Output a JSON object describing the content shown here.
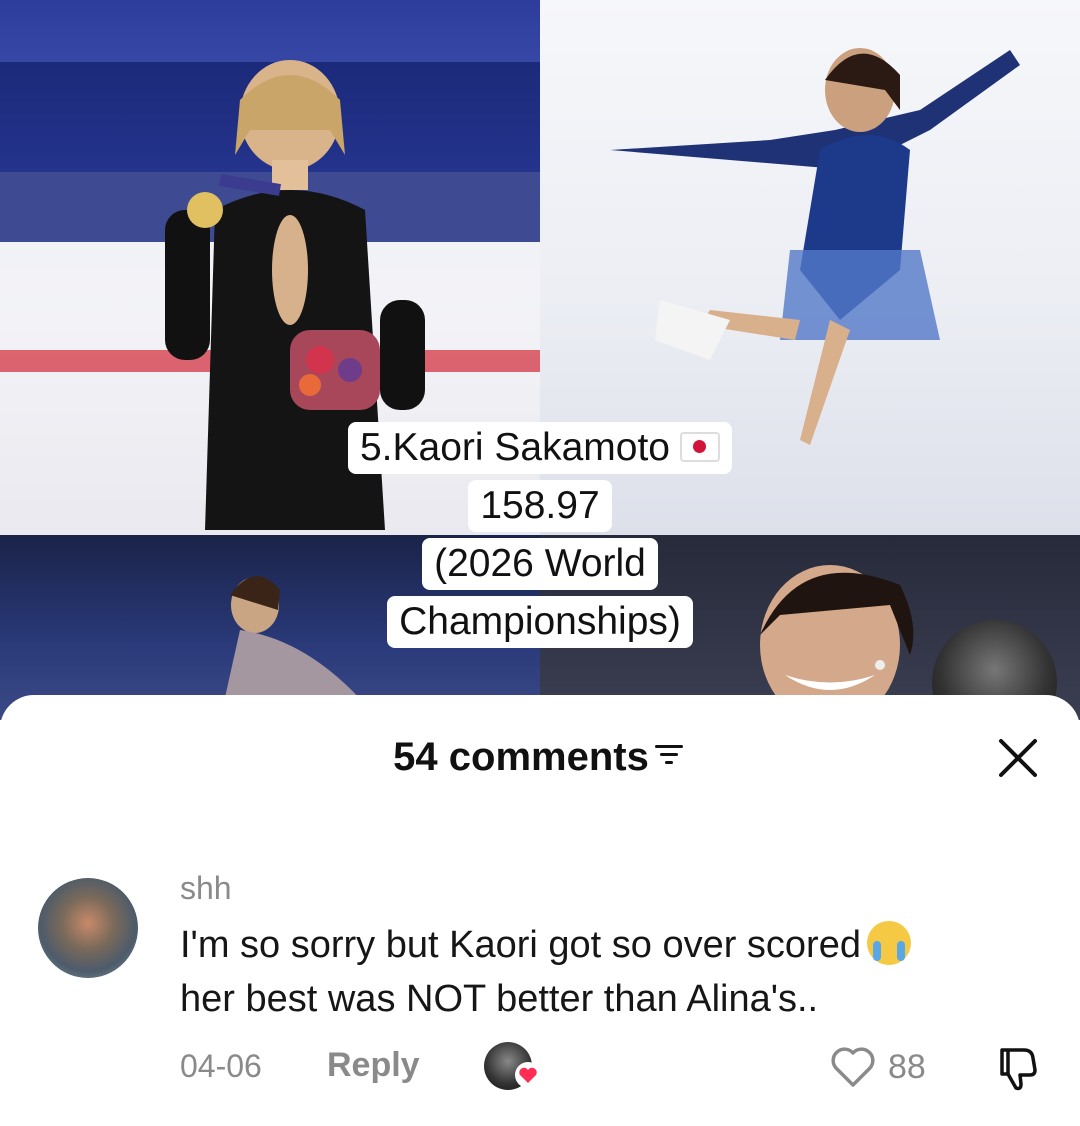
{
  "video": {
    "caption": {
      "line1": "5.Kaori Sakamoto",
      "line2": "158.97",
      "line3": "(2026 World",
      "line4": "Championships)",
      "flag_icon": "japan-flag-icon"
    }
  },
  "comments_sheet": {
    "title": "54 comments",
    "sort_icon": "sort-icon",
    "close_icon": "close-icon"
  },
  "comment": {
    "username": "shh",
    "text_line1": "I'm so sorry but Kaori got so over scored",
    "text_line2": "her best was NOT better than Alina's..",
    "emoji_icon": "loudly-crying-face-icon",
    "date": "04-06",
    "reply_label": "Reply",
    "like_count": "88",
    "like_icon": "heart-outline-icon",
    "dislike_icon": "thumbs-down-icon",
    "creator_liked_icon": "heart-filled-icon"
  },
  "colors": {
    "heart_red": "#ff2c55",
    "muted_text": "#8a8a8a"
  }
}
